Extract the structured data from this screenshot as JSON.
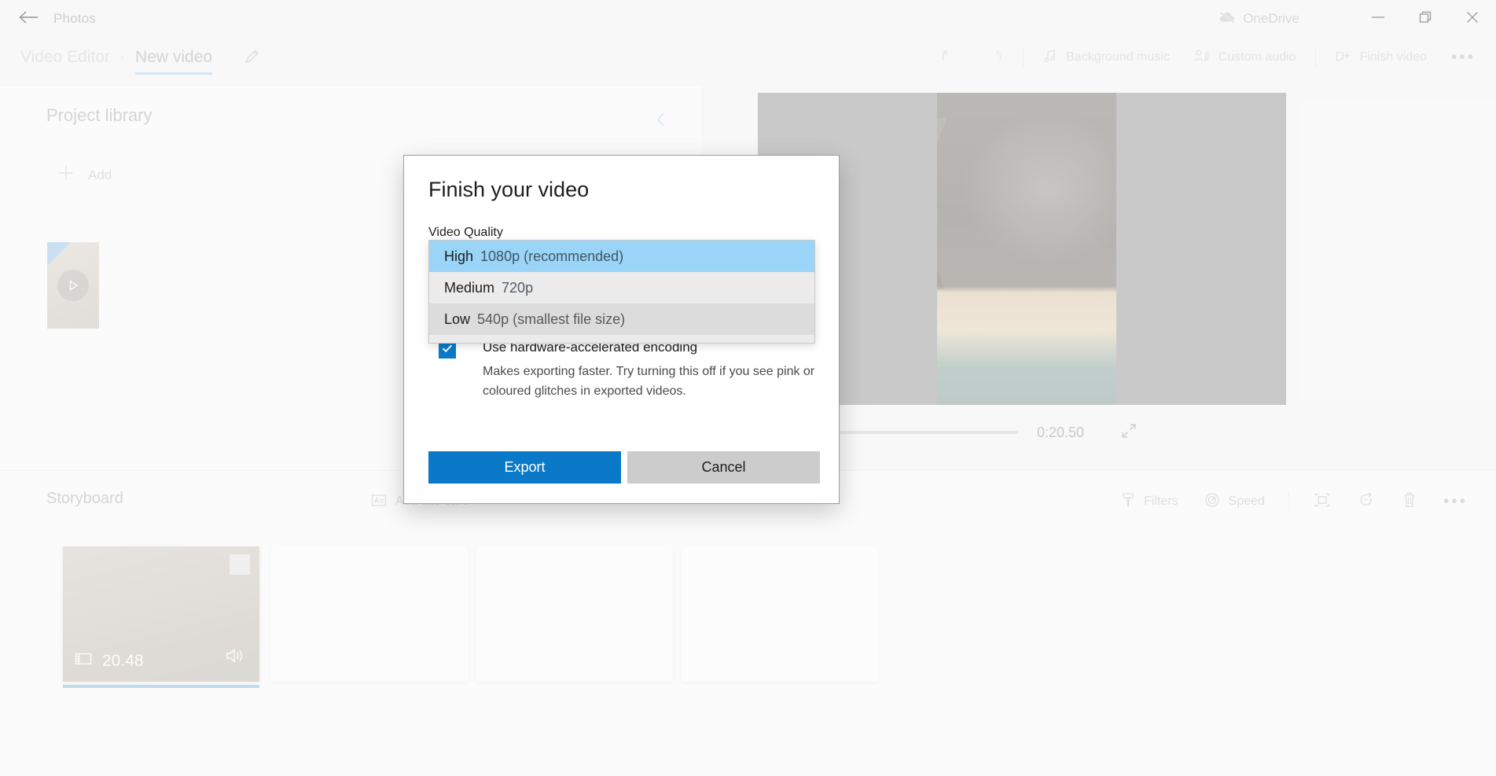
{
  "titlebar": {
    "app_name": "Photos",
    "back_icon": "back-arrow-icon",
    "onedrive_label": "OneDrive",
    "onedrive_icon": "onedrive-paused-cloud-icon",
    "minimize_icon": "minimize-icon",
    "restore_icon": "restore-icon",
    "close_icon": "close-icon"
  },
  "breadcrumb": {
    "parent": "Video Editor",
    "separator": "›",
    "current": "New video",
    "rename_icon": "pencil-icon"
  },
  "commandbar": {
    "undo_icon": "undo-icon",
    "redo_icon": "redo-icon",
    "background_music": "Background music",
    "background_music_icon": "music-note-icon",
    "custom_audio": "Custom audio",
    "custom_audio_icon": "person-audio-icon",
    "finish_video": "Finish video",
    "finish_video_icon": "share-export-icon",
    "overflow": "•••"
  },
  "library": {
    "title": "Project library",
    "collapse_icon": "chevron-left-icon",
    "add_label": "Add",
    "add_icon": "plus-icon",
    "thumbnail_play_icon": "play-icon"
  },
  "preview": {
    "time_label": "0:20.50",
    "expand_icon": "expand-diagonal-icon",
    "play_handle_icon": "timeline-scrubber-handle"
  },
  "storyboard": {
    "title": "Storyboard",
    "tools": [
      {
        "label": "Add title card",
        "icon": "title-card-icon"
      },
      {
        "label": "Filters",
        "icon": "filters-brush-icon"
      },
      {
        "label": "Speed",
        "icon": "speed-gauge-icon"
      }
    ],
    "icon_tools": [
      {
        "icon": "crop-aspect-icon"
      },
      {
        "icon": "rotate-icon"
      },
      {
        "icon": "delete-trash-icon"
      },
      {
        "icon": "more-dots-icon"
      }
    ],
    "clip": {
      "duration": "20.48",
      "film_icon": "film-strip-icon",
      "audio_icon": "speaker-on-icon"
    }
  },
  "dialog": {
    "title": "Finish your video",
    "quality_label": "Video Quality",
    "quality_options": [
      {
        "name": "High",
        "detail": "1080p (recommended)",
        "state": "selected"
      },
      {
        "name": "Medium",
        "detail": "720p",
        "state": "normal"
      },
      {
        "name": "Low",
        "detail": "540p (smallest file size)",
        "state": "hovered"
      }
    ],
    "checkbox": {
      "checked": true,
      "check_icon": "checkmark-icon",
      "label": "Use hardware-accelerated encoding",
      "description": "Makes exporting faster. Try turning this off if you see pink or coloured glitches in exported videos."
    },
    "export_label": "Export",
    "cancel_label": "Cancel"
  },
  "colors": {
    "accent_blue": "#0a7ac8",
    "selection_blue": "#9ad4f7",
    "underline_blue": "#a8cdec",
    "muted_text": "#a9a9a9",
    "dialog_border": "#9e9e9e"
  }
}
